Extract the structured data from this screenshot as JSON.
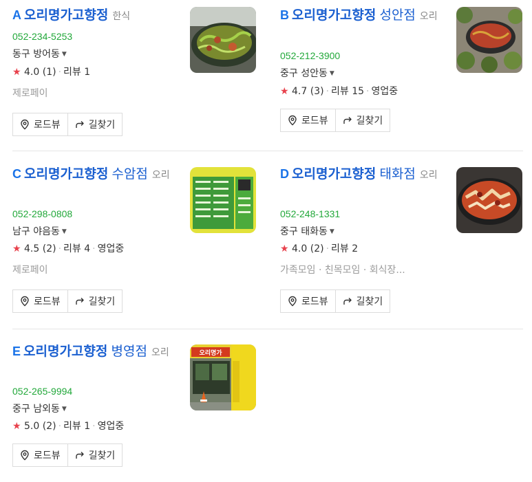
{
  "buttons": {
    "roadview": "로드뷰",
    "directions": "길찾기"
  },
  "icons": {
    "roadview": "map-pin-icon",
    "directions": "share-arrow-icon",
    "star": "star-icon",
    "dropdown": "caret-down-icon"
  },
  "colors": {
    "letter": "#1a73e8",
    "name": "#1a5fd0",
    "phone": "#22a83a",
    "star": "#e8424d"
  },
  "results": [
    {
      "letter": "A",
      "name": "오리명가고향정",
      "branch": "",
      "category": "한식",
      "phone": "052-234-5253",
      "address": "동구 방어동",
      "rating": "4.0 (1)",
      "reviews": "리뷰 1",
      "status": "",
      "tags": "제로페이"
    },
    {
      "letter": "B",
      "name": "오리명가고향정",
      "branch": "성안점",
      "category": "오리",
      "phone": "052-212-3900",
      "address": "중구 성안동",
      "rating": "4.7 (3)",
      "reviews": "리뷰 15",
      "status": "영업중",
      "tags": ""
    },
    {
      "letter": "C",
      "name": "오리명가고향정",
      "branch": "수암점",
      "category": "오리",
      "phone": "052-298-0808",
      "address": "남구 야음동",
      "rating": "4.5 (2)",
      "reviews": "리뷰 4",
      "status": "영업중",
      "tags": "제로페이"
    },
    {
      "letter": "D",
      "name": "오리명가고향정",
      "branch": "태화점",
      "category": "오리",
      "phone": "052-248-1331",
      "address": "중구 태화동",
      "rating": "4.0 (2)",
      "reviews": "리뷰 2",
      "status": "",
      "tags": "가족모임 · 친목모임 · 회식장..."
    },
    {
      "letter": "E",
      "name": "오리명가고향정",
      "branch": "병영점",
      "category": "오리",
      "phone": "052-265-9994",
      "address": "중구 남외동",
      "rating": "5.0 (2)",
      "reviews": "리뷰 1",
      "status": "영업중",
      "tags": ""
    }
  ],
  "thumb_texts": {
    "e_sign": "오리명가"
  }
}
